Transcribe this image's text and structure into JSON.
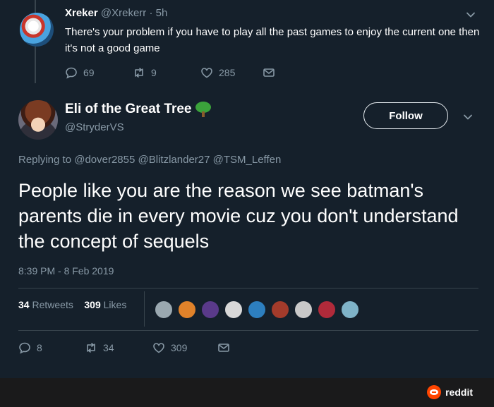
{
  "reply_tweet": {
    "name": "Xreker",
    "handle": "@Xrekerr",
    "separator": "·",
    "time": "5h",
    "text": "There's your problem if you have to play all the past games to enjoy the current one then it's not a good game",
    "replies": "69",
    "retweets": "9",
    "likes": "285"
  },
  "main_tweet": {
    "name": "Eli of the Great Tree",
    "handle": "@StryderVS",
    "follow_label": "Follow",
    "replying_prefix": "Replying to",
    "mentions": [
      "@dover2855",
      "@Blitzlander27",
      "@TSM_Leffen"
    ],
    "text": "People like you are the reason we see batman's parents die in every movie cuz you don't understand the concept of sequels",
    "timestamp": "8:39 PM - 8 Feb 2019",
    "retweet_count": "34",
    "retweets_label": "Retweets",
    "like_count": "309",
    "likes_label": "Likes",
    "actions": {
      "replies": "8",
      "retweets": "34",
      "likes": "309"
    }
  },
  "footer": {
    "brand": "reddit"
  },
  "colors": {
    "background": "#15202b",
    "secondary_text": "#8899a6",
    "divider": "#38444d",
    "reddit_orange": "#ff4500"
  },
  "icons": [
    "reply-icon",
    "retweet-icon",
    "like-icon",
    "message-icon",
    "chevron-down-icon",
    "tree-emoji-icon",
    "reddit-logo-icon"
  ]
}
